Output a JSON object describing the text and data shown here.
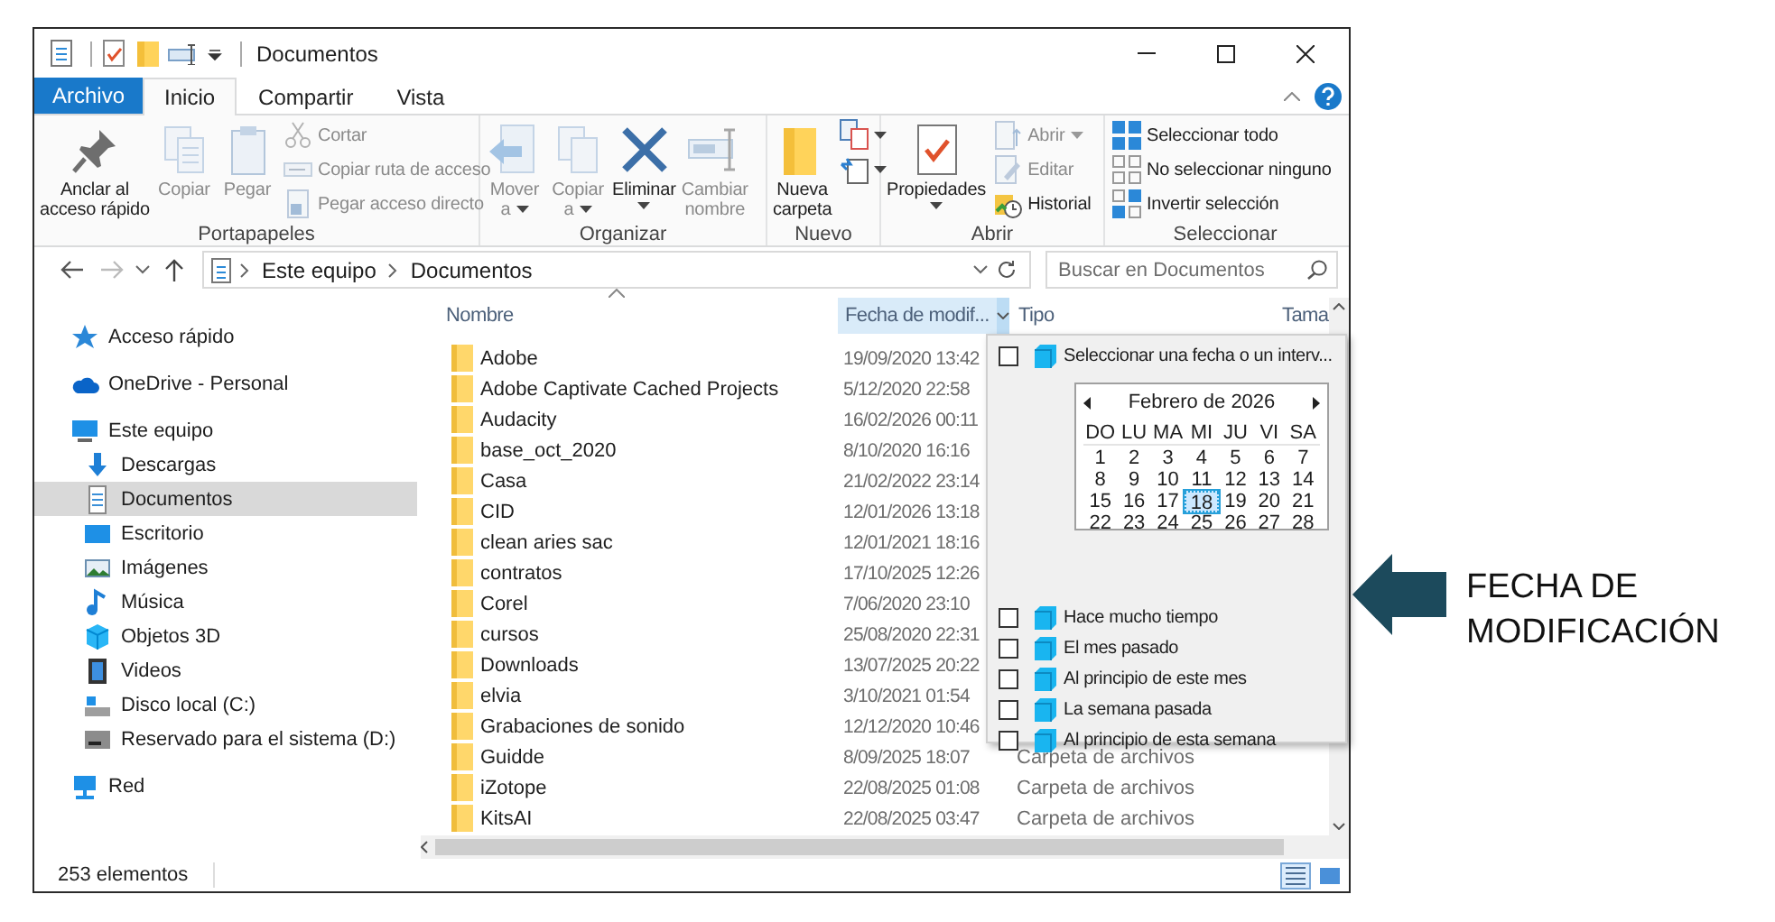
{
  "window": {
    "title": "Documentos"
  },
  "ribbon": {
    "tabs": [
      {
        "label": "Archivo",
        "kind": "file",
        "selected": false
      },
      {
        "label": "Inicio",
        "kind": "tab",
        "selected": true
      },
      {
        "label": "Compartir",
        "kind": "tab",
        "selected": false
      },
      {
        "label": "Vista",
        "kind": "tab",
        "selected": false
      }
    ],
    "groups": [
      {
        "label": "Portapapeles",
        "commands": [
          {
            "kind": "large",
            "label": "Anclar al\nacceso rápido",
            "disabled": false
          },
          {
            "kind": "large",
            "label": "Copiar",
            "disabled": true
          },
          {
            "kind": "large",
            "label": "Pegar",
            "disabled": true
          },
          {
            "kind": "small",
            "label": "Cortar",
            "disabled": true
          },
          {
            "kind": "small",
            "label": "Copiar ruta de acceso",
            "disabled": true
          },
          {
            "kind": "small",
            "label": "Pegar acceso directo",
            "disabled": true
          }
        ]
      },
      {
        "label": "Organizar",
        "commands": [
          {
            "kind": "large",
            "label": "Mover\na",
            "disabled": true,
            "dropdown": true
          },
          {
            "kind": "large",
            "label": "Copiar\na",
            "disabled": true,
            "dropdown": true
          },
          {
            "kind": "large",
            "label": "Eliminar",
            "disabled": false,
            "dropdown": true
          },
          {
            "kind": "large",
            "label": "Cambiar\nnombre",
            "disabled": true
          }
        ]
      },
      {
        "label": "Nuevo",
        "commands": [
          {
            "kind": "large",
            "label": "Nueva\ncarpeta",
            "disabled": false
          },
          {
            "kind": "icon",
            "disabled": false,
            "dropdown": true
          },
          {
            "kind": "icon",
            "disabled": false,
            "dropdown": true
          }
        ]
      },
      {
        "label": "Abrir",
        "commands": [
          {
            "kind": "large",
            "label": "Propiedades",
            "disabled": false,
            "dropdown": true
          },
          {
            "kind": "small",
            "label": "Abrir",
            "disabled": true,
            "dropdown": true
          },
          {
            "kind": "small",
            "label": "Editar",
            "disabled": true
          },
          {
            "kind": "small",
            "label": "Historial",
            "disabled": false
          }
        ]
      },
      {
        "label": "Seleccionar",
        "commands": [
          {
            "kind": "small",
            "label": "Seleccionar todo",
            "disabled": false
          },
          {
            "kind": "small",
            "label": "No seleccionar ninguno",
            "disabled": false
          },
          {
            "kind": "small",
            "label": "Invertir selección",
            "disabled": false
          }
        ]
      }
    ]
  },
  "navigation": {
    "back_disabled": false,
    "forward_disabled": true
  },
  "address_bar": {
    "crumbs": [
      "Este equipo",
      "Documentos"
    ]
  },
  "search": {
    "placeholder": "Buscar en Documentos"
  },
  "nav": {
    "items": [
      {
        "label": "Acceso rápido",
        "selected": false
      },
      {
        "label": "OneDrive - Personal",
        "selected": false
      },
      {
        "label": "Este equipo",
        "selected": false,
        "children": [
          {
            "label": "Descargas",
            "selected": false
          },
          {
            "label": "Documentos",
            "selected": true
          },
          {
            "label": "Escritorio",
            "selected": false
          },
          {
            "label": "Imágenes",
            "selected": false
          },
          {
            "label": "Música",
            "selected": false
          },
          {
            "label": "Objetos 3D",
            "selected": false
          },
          {
            "label": "Videos",
            "selected": false
          },
          {
            "label": "Disco local (C:)",
            "selected": false
          },
          {
            "label": "Reservado para el sistema (D:)",
            "selected": false
          }
        ]
      },
      {
        "label": "Red",
        "selected": false
      }
    ]
  },
  "file_list": {
    "columns": [
      {
        "label": "Nombre",
        "selected": false,
        "sorted": true
      },
      {
        "label": "Fecha de modif...",
        "selected": true
      },
      {
        "label": "Tipo",
        "selected": false
      },
      {
        "label": "Tama",
        "selected": false
      }
    ],
    "rows": [
      {
        "name": "Adobe",
        "date": "19/09/2020 13:42"
      },
      {
        "name": "Adobe Captivate Cached Projects",
        "date": "5/12/2020 22:58"
      },
      {
        "name": "Audacity",
        "date": "16/02/2026 00:11"
      },
      {
        "name": "base_oct_2020",
        "date": "8/10/2020 16:16"
      },
      {
        "name": "Casa",
        "date": "21/02/2022 23:14"
      },
      {
        "name": "CID",
        "date": "12/01/2026 13:18"
      },
      {
        "name": "clean aries sac",
        "date": "12/01/2021 18:16"
      },
      {
        "name": "contratos",
        "date": "17/10/2025 12:26"
      },
      {
        "name": "Corel",
        "date": "7/06/2020 23:10"
      },
      {
        "name": "cursos",
        "date": "25/08/2020 22:31"
      },
      {
        "name": "Downloads",
        "date": "13/07/2025 20:22"
      },
      {
        "name": "elvia",
        "date": "3/10/2021 01:54"
      },
      {
        "name": "Grabaciones de sonido",
        "date": "12/12/2020 10:46"
      },
      {
        "name": "Guidde",
        "date": "8/09/2025 18:07",
        "type": "Carpeta de archivos"
      },
      {
        "name": "iZotope",
        "date": "22/08/2025 01:08",
        "type": "Carpeta de archivos"
      },
      {
        "name": "KitsAI",
        "date": "22/08/2025 03:47",
        "type": "Carpeta de archivos"
      }
    ]
  },
  "date_filter": {
    "options": [
      {
        "label": "Seleccionar una fecha o un interv...",
        "checked": false
      },
      {
        "label": "Hace mucho tiempo",
        "checked": false
      },
      {
        "label": "El mes pasado",
        "checked": false
      },
      {
        "label": "Al principio de este mes",
        "checked": false
      },
      {
        "label": "La semana pasada",
        "checked": false
      },
      {
        "label": "Al principio de esta semana",
        "checked": false
      }
    ],
    "calendar": {
      "month": "Febrero de 2026",
      "weekdays": [
        "DO",
        "LU",
        "MA",
        "MI",
        "JU",
        "VI",
        "SA"
      ],
      "days": [
        {
          "label": "1",
          "selected": false
        },
        {
          "label": "2",
          "selected": false
        },
        {
          "label": "3",
          "selected": false
        },
        {
          "label": "4",
          "selected": false
        },
        {
          "label": "5",
          "selected": false
        },
        {
          "label": "6",
          "selected": false
        },
        {
          "label": "7",
          "selected": false
        },
        {
          "label": "8",
          "selected": false
        },
        {
          "label": "9",
          "selected": false
        },
        {
          "label": "10",
          "selected": false
        },
        {
          "label": "11",
          "selected": false
        },
        {
          "label": "12",
          "selected": false
        },
        {
          "label": "13",
          "selected": false
        },
        {
          "label": "14",
          "selected": false
        },
        {
          "label": "15",
          "selected": false
        },
        {
          "label": "16",
          "selected": false
        },
        {
          "label": "17",
          "selected": false
        },
        {
          "label": "18",
          "selected": true
        },
        {
          "label": "19",
          "selected": false
        },
        {
          "label": "20",
          "selected": false
        },
        {
          "label": "21",
          "selected": false
        },
        {
          "label": "22",
          "selected": false
        },
        {
          "label": "23",
          "selected": false
        },
        {
          "label": "24",
          "selected": false
        },
        {
          "label": "25",
          "selected": false
        },
        {
          "label": "26",
          "selected": false
        },
        {
          "label": "27",
          "selected": false
        },
        {
          "label": "28",
          "selected": false
        }
      ]
    }
  },
  "status_bar": {
    "count": "253 elementos",
    "views": [
      {
        "selected": true
      },
      {
        "selected": false
      }
    ]
  },
  "callout": {
    "lines": [
      "FECHA DE",
      "MODIFICACIÓN"
    ]
  }
}
